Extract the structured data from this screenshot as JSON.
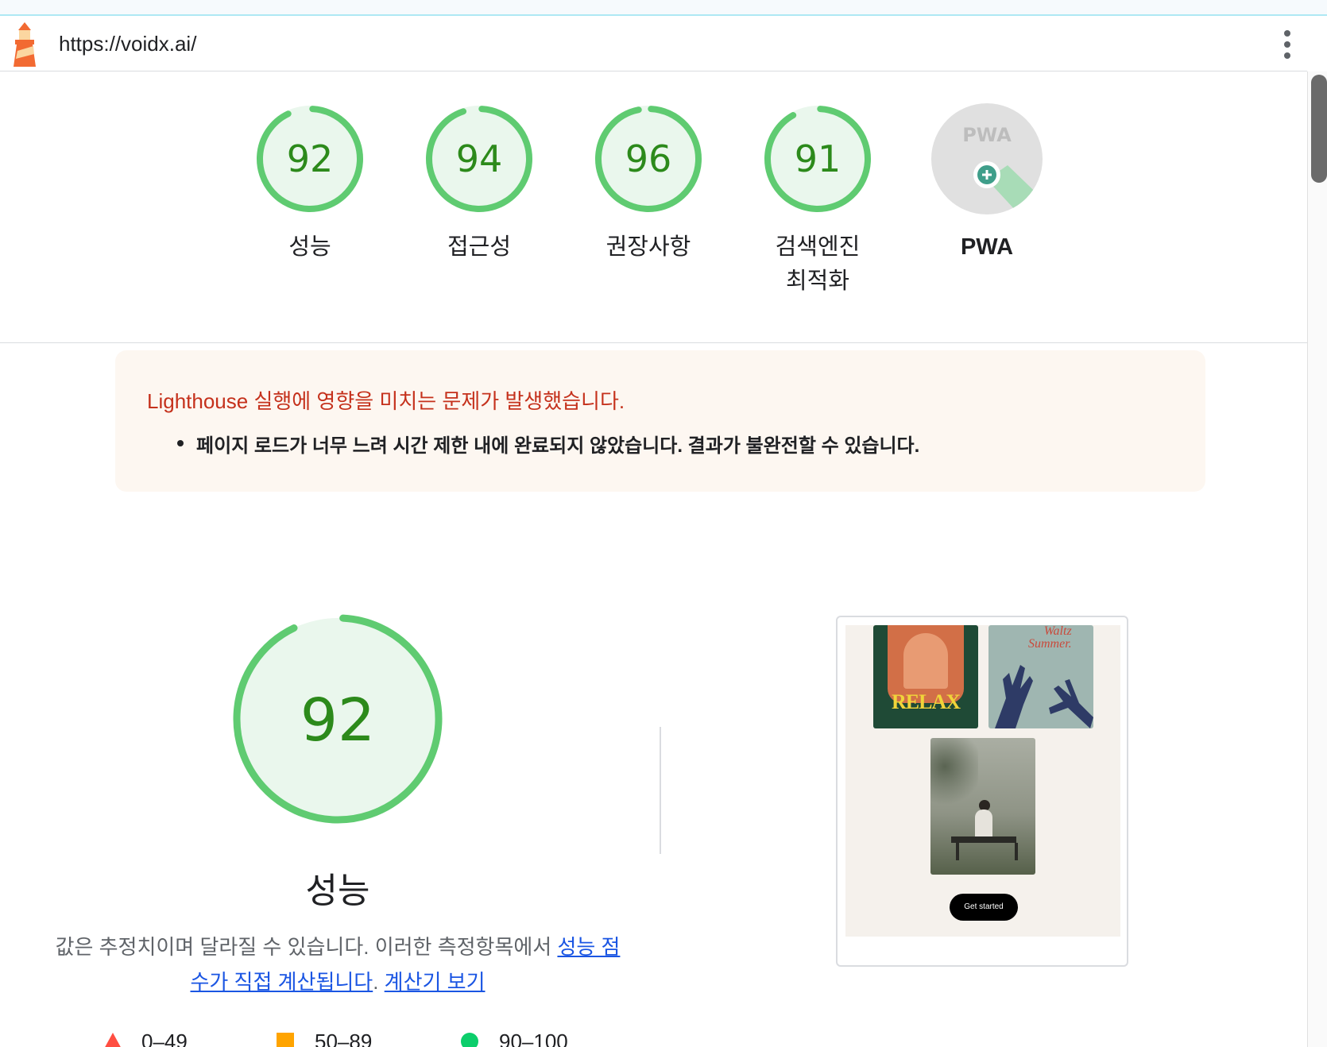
{
  "header": {
    "url": "https://voidx.ai/",
    "logo_icon": "lighthouse-icon",
    "menu_icon": "kebab-menu-icon"
  },
  "colors": {
    "pass": "#0cce6b",
    "pass_ring": "#5fcb71",
    "pass_text": "#2c8a1b",
    "pass_fill": "#eaf7ed",
    "average": "#ffa400",
    "fail": "#ff4e42",
    "warning_text": "#c5311c",
    "link": "#1a55e3"
  },
  "gauges": [
    {
      "score": 92,
      "label": "성능"
    },
    {
      "score": 94,
      "label": "접근성"
    },
    {
      "score": 96,
      "label": "권장사항"
    },
    {
      "score": 91,
      "label": "검색엔진\n최적화"
    },
    {
      "label": "PWA",
      "badge": "PWA",
      "icon": "pwa-badge-icon"
    }
  ],
  "warning": {
    "title": "Lighthouse 실행에 영향을 미치는 문제가 발생했습니다.",
    "item": "페이지 로드가 너무 느려 시간 제한 내에 완료되지 않았습니다. 결과가 불완전할 수 있습니다."
  },
  "performance": {
    "score": 92,
    "title": "성능",
    "desc_text": "값은 추정치이며 달라질 수 있습니다. 이러한 측정항목에서 ",
    "desc_link": "성능 점수가 직접 계산됩니다",
    "desc_sep": ". ",
    "calc_link": "계산기 보기"
  },
  "screenshot": {
    "poster1_text": "RELAX",
    "poster2_text": "Waltz\nSummer.",
    "button": "Get started"
  },
  "legend": [
    {
      "range": "0–49",
      "icon": "fail-triangle-icon"
    },
    {
      "range": "50–89",
      "icon": "average-square-icon"
    },
    {
      "range": "90–100",
      "icon": "pass-circle-icon"
    }
  ]
}
